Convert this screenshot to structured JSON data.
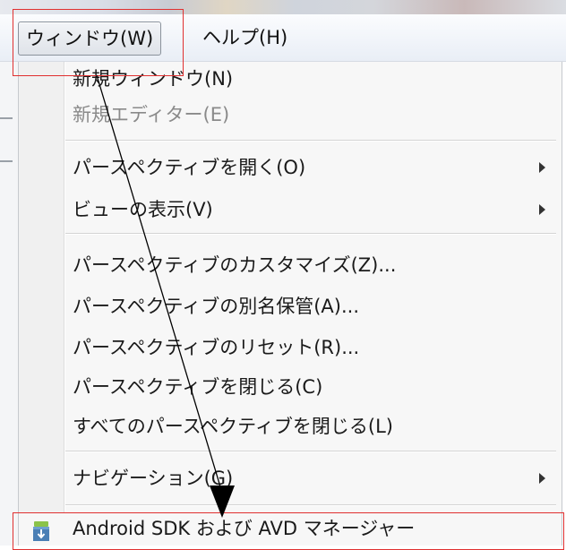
{
  "menubar": {
    "window_label": "ウィンドウ(W)",
    "help_label": "ヘルプ(H)"
  },
  "window_menu": {
    "items": [
      {
        "label": "新規ウィンドウ(N)",
        "enabled": true,
        "submenu": false
      },
      {
        "label": "新規エディター(E)",
        "enabled": false,
        "submenu": false
      },
      {
        "label": "パースペクティブを開く(O)",
        "enabled": true,
        "submenu": true
      },
      {
        "label": "ビューの表示(V)",
        "enabled": true,
        "submenu": true
      },
      {
        "label": "パースペクティブのカスタマイズ(Z)...",
        "enabled": true,
        "submenu": false
      },
      {
        "label": "パースペクティブの別名保管(A)...",
        "enabled": true,
        "submenu": false
      },
      {
        "label": "パースペクティブのリセット(R)...",
        "enabled": true,
        "submenu": false
      },
      {
        "label": "パースペクティブを閉じる(C)",
        "enabled": true,
        "submenu": false
      },
      {
        "label": "すべてのパースペクティブを閉じる(L)",
        "enabled": true,
        "submenu": false
      },
      {
        "label": "ナビゲーション(G)",
        "enabled": true,
        "submenu": true
      }
    ],
    "android_item": {
      "label": "Android SDK および AVD マネージャー",
      "icon": "android-sdk-manager-icon"
    }
  },
  "annotations": {
    "color": "#e03030",
    "arrow_color": "#000000"
  }
}
